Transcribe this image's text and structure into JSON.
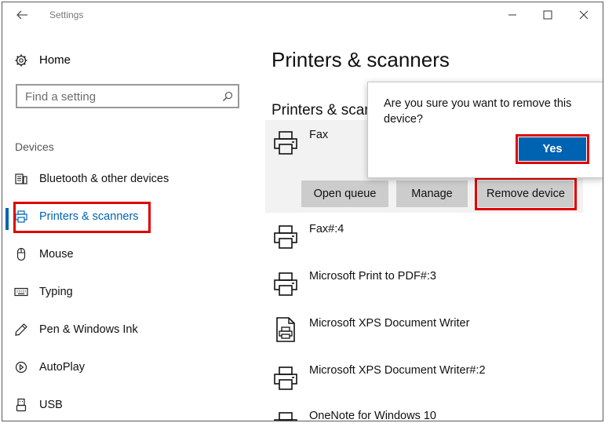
{
  "window": {
    "title": "Settings"
  },
  "sidebar": {
    "home_label": "Home",
    "search_placeholder": "Find a setting",
    "section_label": "Devices",
    "items": [
      {
        "label": "Bluetooth & other devices",
        "icon": "bluetooth-devices-icon"
      },
      {
        "label": "Printers & scanners",
        "icon": "printer-icon",
        "active": true
      },
      {
        "label": "Mouse",
        "icon": "mouse-icon"
      },
      {
        "label": "Typing",
        "icon": "keyboard-icon"
      },
      {
        "label": "Pen & Windows Ink",
        "icon": "pen-icon"
      },
      {
        "label": "AutoPlay",
        "icon": "autoplay-icon"
      },
      {
        "label": "USB",
        "icon": "usb-icon"
      }
    ]
  },
  "main": {
    "title": "Printers & scanners",
    "subheading": "Printers & scanners",
    "selected_device": {
      "name": "Fax",
      "buttons": {
        "open_queue": "Open queue",
        "manage": "Manage",
        "remove_device": "Remove device"
      }
    },
    "devices": [
      {
        "name": "Fax#:4",
        "icon": "printer-icon"
      },
      {
        "name": "Microsoft Print to PDF#:3",
        "icon": "printer-icon"
      },
      {
        "name": "Microsoft XPS Document Writer",
        "icon": "document-printer-icon"
      },
      {
        "name": "Microsoft XPS Document Writer#:2",
        "icon": "printer-icon"
      },
      {
        "name": "OneNote for Windows 10",
        "icon": "printer-icon"
      }
    ]
  },
  "confirm_dialog": {
    "message": "Are you sure you want to remove this device?",
    "yes_label": "Yes"
  },
  "colors": {
    "accent": "#0063b1",
    "highlight": "#e00000",
    "selected_bg": "#f2f2f2",
    "button_bg": "#cccccc"
  }
}
